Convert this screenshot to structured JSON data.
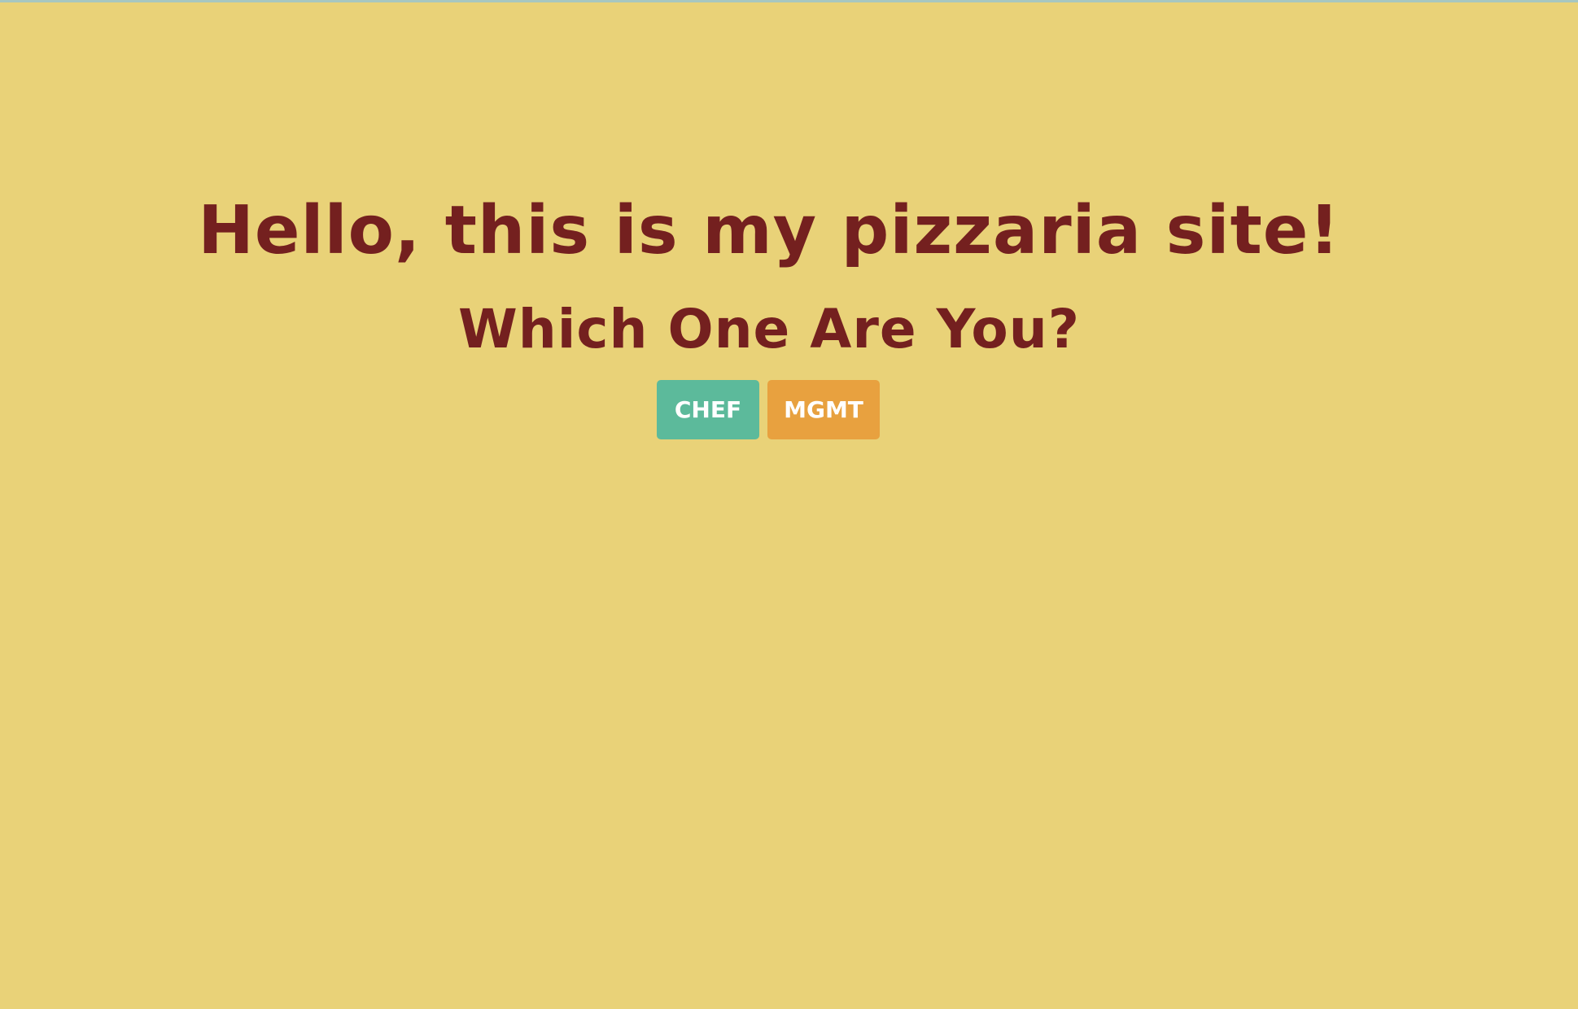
{
  "page": {
    "headline": "Hello, this is my pizzaria site!",
    "subheadline": "Which One Are You?"
  },
  "actions": {
    "chef_label": "CHEF",
    "mgmt_label": "MGMT"
  },
  "colors": {
    "background": "#e9d278",
    "heading_text": "#74201f",
    "chef_button": "#5cba9b",
    "mgmt_button": "#e8a13f",
    "button_text": "#ffffff"
  }
}
